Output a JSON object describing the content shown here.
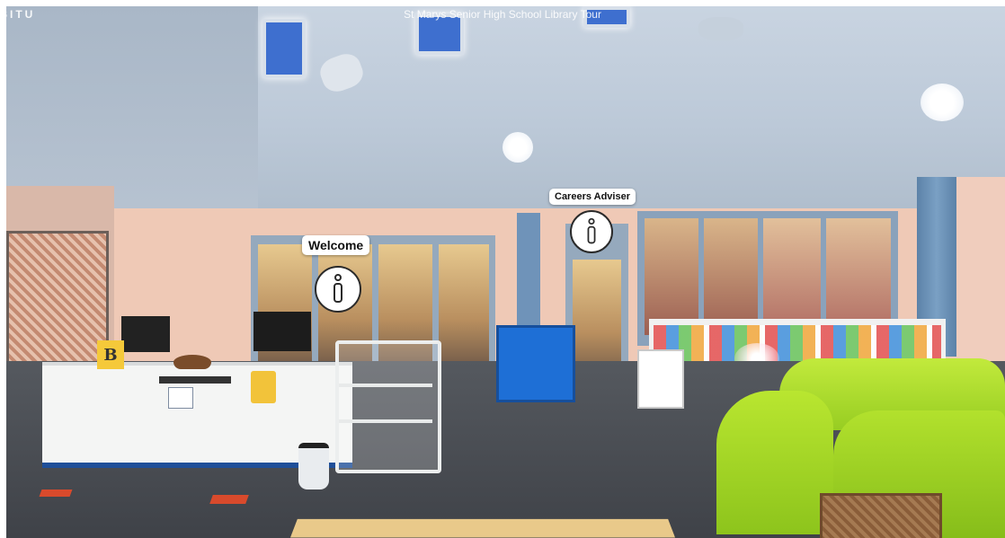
{
  "brand": {
    "text": "SITU"
  },
  "tour": {
    "title": "St Marys Senior High School Library Tour"
  },
  "hotspots": [
    {
      "label": "Welcome",
      "icon": "info-icon"
    },
    {
      "label": "Careers Adviser",
      "icon": "info-icon"
    }
  ],
  "scene": {
    "desk_sign_letter": "B"
  },
  "colors": {
    "hotspot_bg": "#ffffff",
    "hotspot_border": "#2a2a2a",
    "sofa_green": "#a6d92a",
    "desk_trim_blue": "#1f4f99",
    "wall_peach": "#efc9b6",
    "ceiling_blue_grey": "#bcc9d8"
  }
}
